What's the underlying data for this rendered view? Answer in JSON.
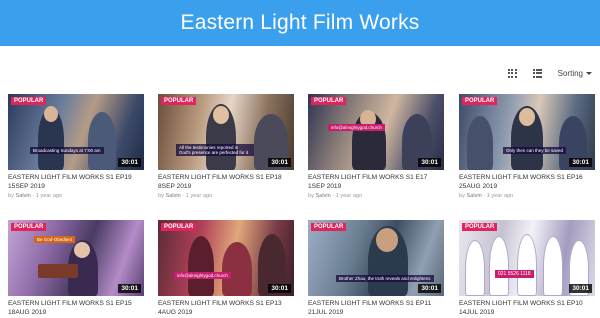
{
  "header": {
    "title": "Eastern Light Film Works"
  },
  "toolbar": {
    "sorting_label": "Sorting"
  },
  "colors": {
    "header_bg": "#3aa0ee",
    "popular_badge": "#e0245e"
  },
  "videos": [
    {
      "title": "EASTERN LIGHT FILM WORKS S1 EP19 15SEP 2019",
      "badge": "POPULAR",
      "duration": "30:01",
      "author": "Salvin",
      "age": "1 year ago",
      "overlay": "Broadcasting Sundays at 7:00 am"
    },
    {
      "title": "EASTERN LIGHT FILM WORKS S1 EP18 8SEP 2019",
      "badge": "POPULAR",
      "duration": "30:01",
      "author": "Salvin",
      "age": "1 year ago",
      "overlay": "All the testimonies reported in God's presence are perfected for it"
    },
    {
      "title": "EASTERN LIGHT FILM WORKS S1 E17 1SEP 2019",
      "badge": "POPULAR",
      "duration": "30:01",
      "author": "Salvin",
      "age": "1 year ago",
      "overlay": "info@almightygod.church"
    },
    {
      "title": "EASTERN LIGHT FILM WORKS S1 EP16 25AUG 2019",
      "badge": "POPULAR",
      "duration": "30:01",
      "author": "Salvin",
      "age": "1 year ago",
      "overlay": "Only then can they be saved"
    },
    {
      "title": "EASTERN LIGHT FILM WORKS S1 EP15 18AUG 2019",
      "badge": "POPULAR",
      "duration": "30:01",
      "author": "",
      "age": "",
      "overlay": "Be God-Obedient"
    },
    {
      "title": "EASTERN LIGHT FILM WORKS S1 EP13 4AUG 2019",
      "badge": "POPULAR",
      "duration": "30:01",
      "author": "",
      "age": "",
      "overlay": "info@almightygod.church"
    },
    {
      "title": "EASTERN LIGHT FILM WORKS S1 EP11 21JUL 2019",
      "badge": "POPULAR",
      "duration": "30:01",
      "author": "",
      "age": "",
      "overlay": "Brother Zhao, the truth reveals and enlightens"
    },
    {
      "title": "EASTERN LIGHT FILM WORKS S1 EP10 14JUL 2019",
      "badge": "POPULAR",
      "duration": "30:01",
      "author": "",
      "age": "",
      "overlay": "021 5526 1118"
    }
  ],
  "meta_by": "by"
}
